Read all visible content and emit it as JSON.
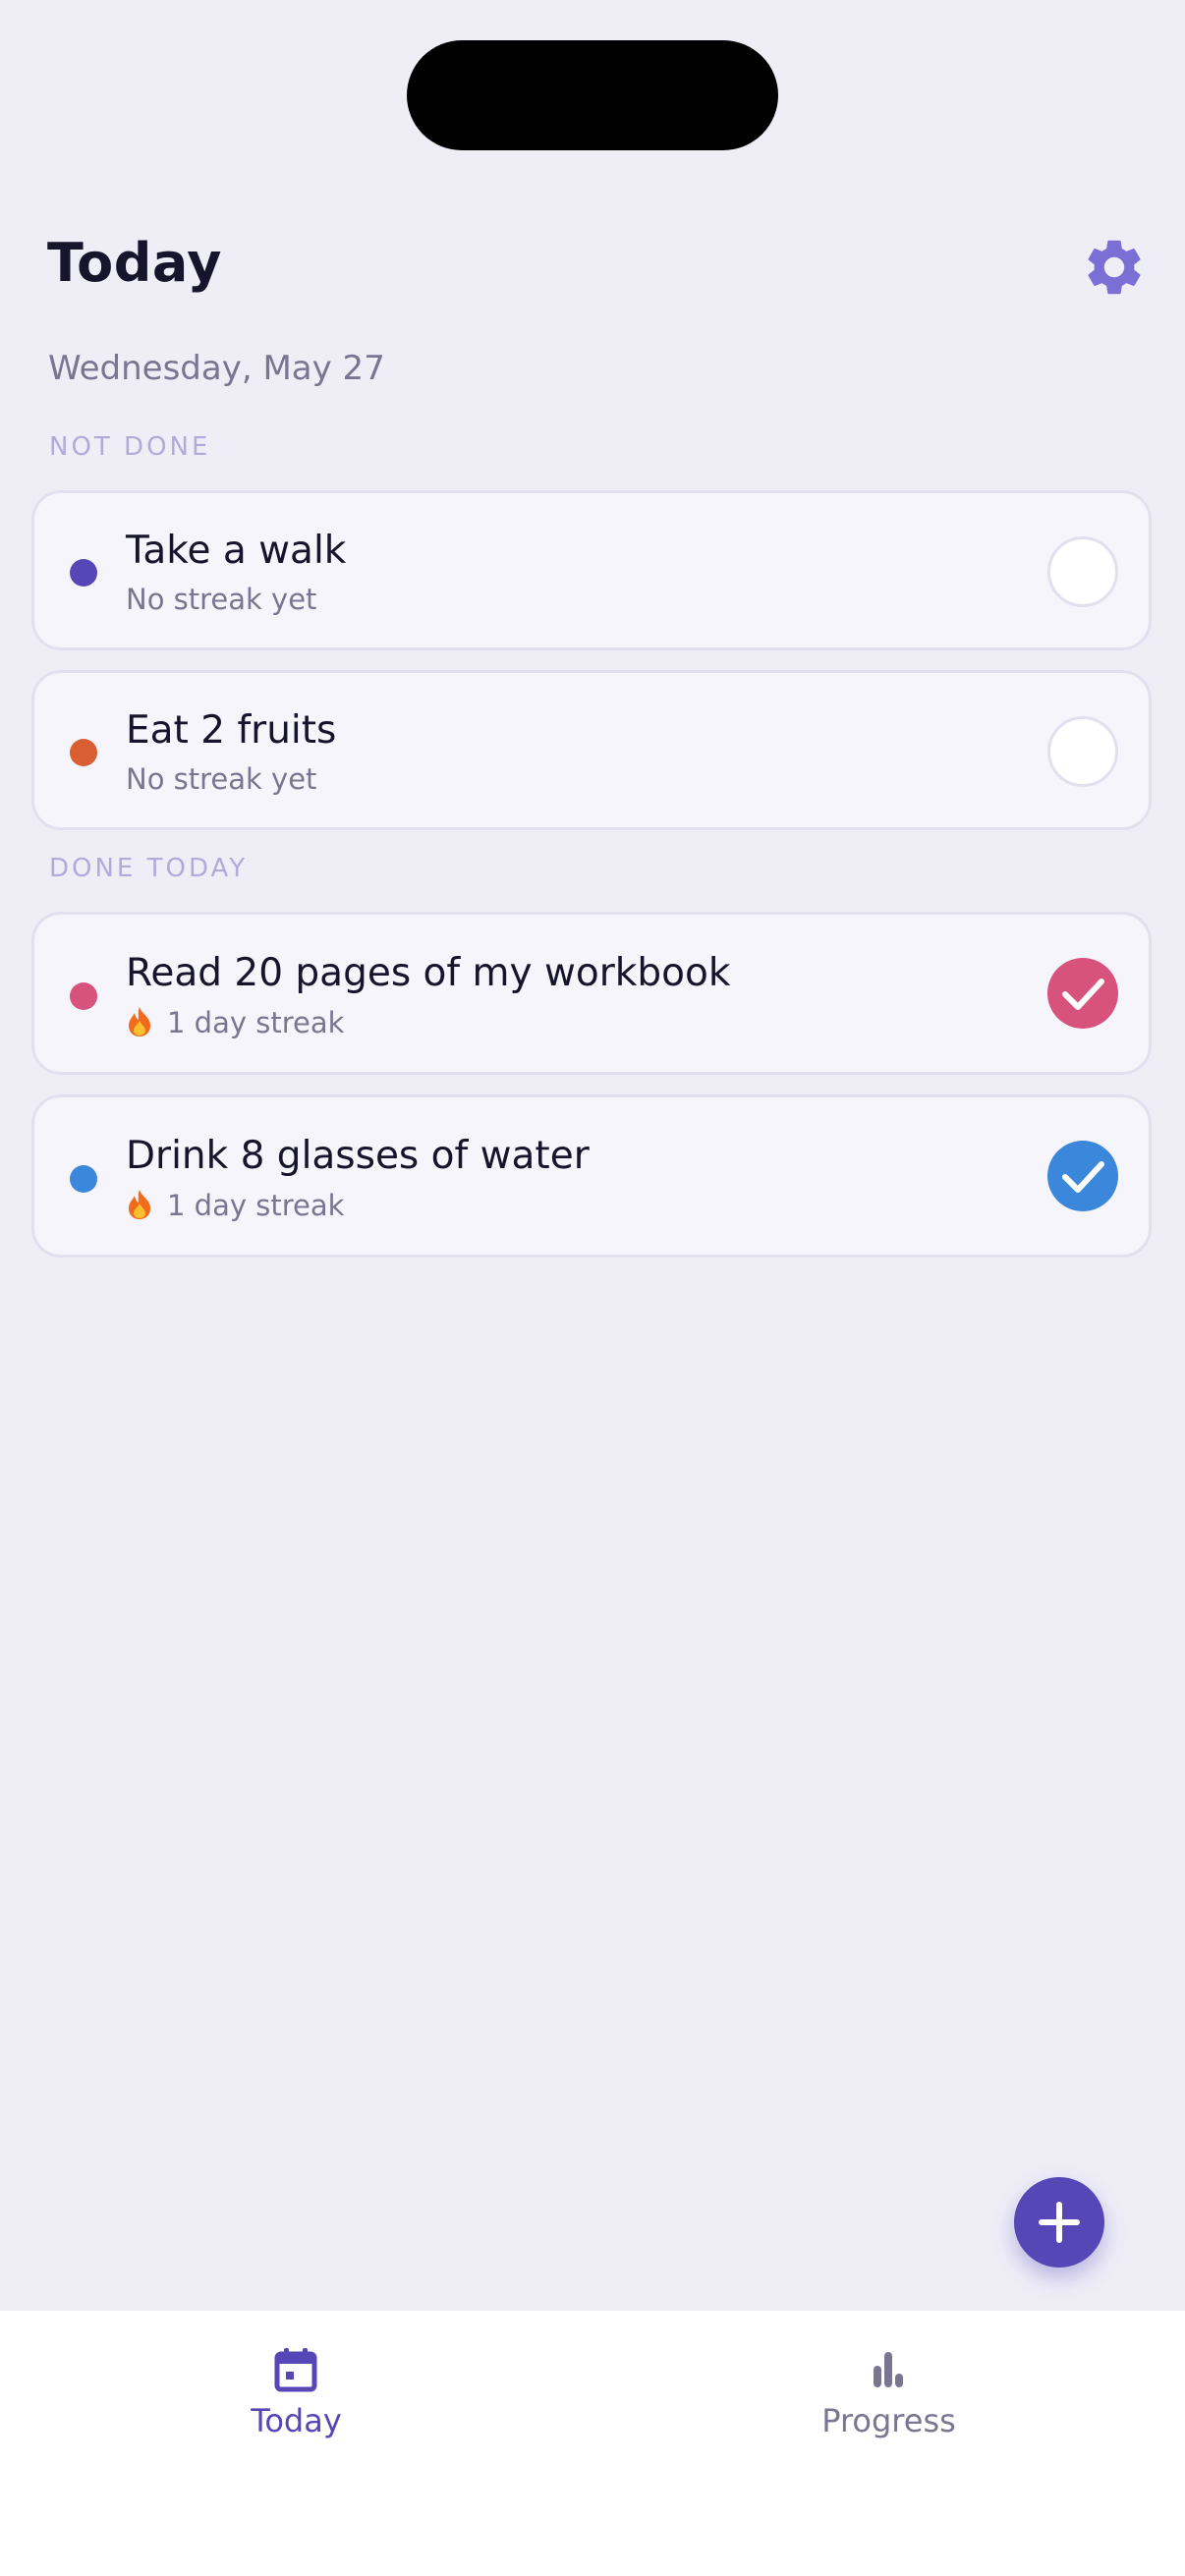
{
  "header": {
    "title": "Today",
    "date": "Wednesday, May 27"
  },
  "sections": {
    "not_done": "NOT DONE",
    "done_today": "DONE TODAY"
  },
  "habits": [
    {
      "name": "Take a walk",
      "subtitle": "No streak yet",
      "color": "#5646b6",
      "done": false,
      "streak_icon": false
    },
    {
      "name": "Eat 2 fruits",
      "subtitle": "No streak yet",
      "color": "#d95f33",
      "done": false,
      "streak_icon": false
    },
    {
      "name": "Read 20 pages of my workbook",
      "subtitle": "1 day streak",
      "color": "#d8527e",
      "done": true,
      "streak_icon": true
    },
    {
      "name": "Drink 8 glasses of water",
      "subtitle": "1 day streak",
      "color": "#3b87dc",
      "done": true,
      "streak_icon": true
    }
  ],
  "tabs": {
    "today": "Today",
    "progress": "Progress"
  },
  "colors": {
    "accent": "#5646b6",
    "gear": "#7b6fd6",
    "inactive_tab": "#7a7691"
  },
  "icons": {
    "settings": "gear-icon",
    "add": "plus-icon",
    "today_tab": "calendar-icon",
    "progress_tab": "bar-chart-icon",
    "streak": "flame-icon"
  }
}
